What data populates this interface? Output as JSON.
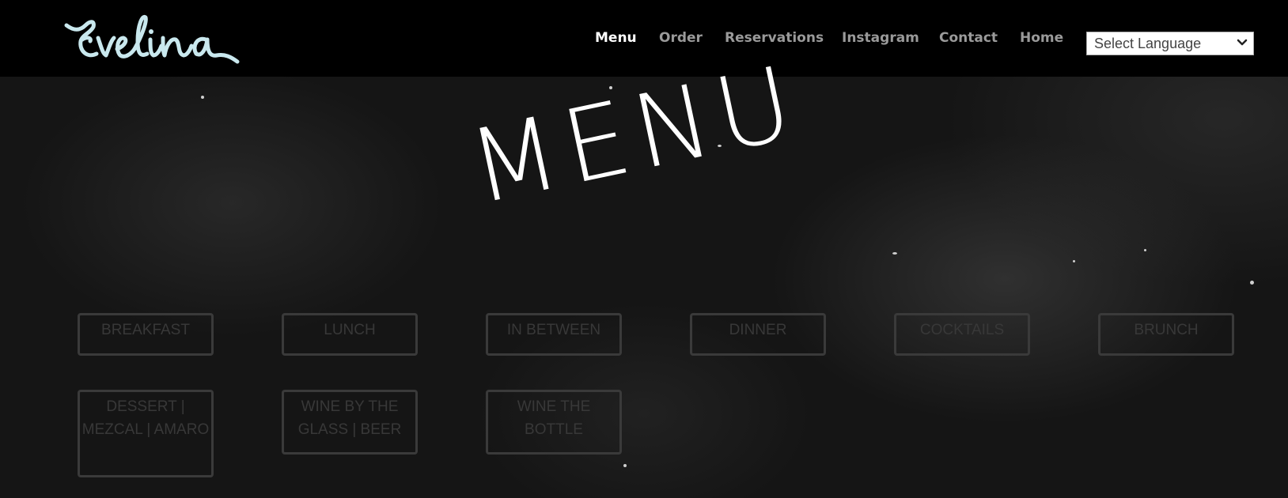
{
  "logo": {
    "text": "Evelina",
    "color": "#c9e8ee"
  },
  "nav": {
    "items": [
      {
        "label": "Menu",
        "active": true
      },
      {
        "label": "Order"
      },
      {
        "label": "Reservations"
      },
      {
        "label": "Instagram"
      },
      {
        "label": "Contact"
      },
      {
        "label": "Home"
      }
    ],
    "language_select": {
      "value": "Select Language",
      "icon": "chevron-down-icon"
    }
  },
  "hero": {
    "title": "MENU"
  },
  "categories": [
    {
      "label": "BREAKFAST"
    },
    {
      "label": "LUNCH"
    },
    {
      "label": "IN BETWEEN"
    },
    {
      "label": "DINNER"
    },
    {
      "label": "COCKTAILS"
    },
    {
      "label": "BRUNCH"
    },
    {
      "label": "DESSERT | MEZCAL | AMARO"
    },
    {
      "label": "WINE BY THE GLASS | BEER"
    },
    {
      "label": "WINE THE BOTTLE"
    }
  ]
}
